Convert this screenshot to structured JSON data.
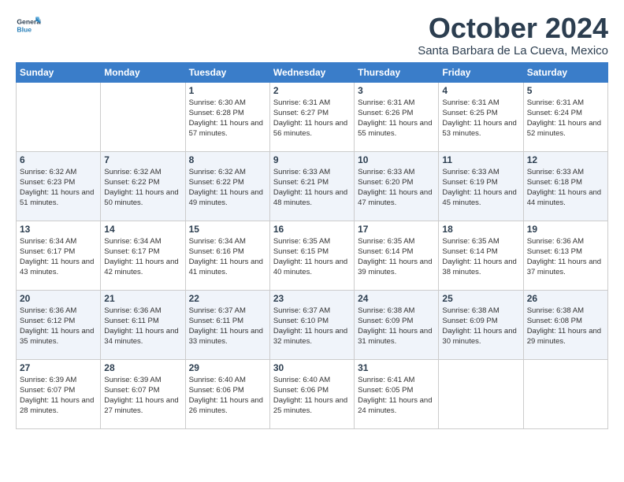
{
  "header": {
    "logo_line1": "General",
    "logo_line2": "Blue",
    "month": "October 2024",
    "location": "Santa Barbara de La Cueva, Mexico"
  },
  "weekdays": [
    "Sunday",
    "Monday",
    "Tuesday",
    "Wednesday",
    "Thursday",
    "Friday",
    "Saturday"
  ],
  "weeks": [
    [
      {
        "day": null
      },
      {
        "day": null
      },
      {
        "day": "1",
        "sunrise": "6:30 AM",
        "sunset": "6:28 PM",
        "daylight": "11 hours and 57 minutes."
      },
      {
        "day": "2",
        "sunrise": "6:31 AM",
        "sunset": "6:27 PM",
        "daylight": "11 hours and 56 minutes."
      },
      {
        "day": "3",
        "sunrise": "6:31 AM",
        "sunset": "6:26 PM",
        "daylight": "11 hours and 55 minutes."
      },
      {
        "day": "4",
        "sunrise": "6:31 AM",
        "sunset": "6:25 PM",
        "daylight": "11 hours and 53 minutes."
      },
      {
        "day": "5",
        "sunrise": "6:31 AM",
        "sunset": "6:24 PM",
        "daylight": "11 hours and 52 minutes."
      }
    ],
    [
      {
        "day": "6",
        "sunrise": "6:32 AM",
        "sunset": "6:23 PM",
        "daylight": "11 hours and 51 minutes."
      },
      {
        "day": "7",
        "sunrise": "6:32 AM",
        "sunset": "6:22 PM",
        "daylight": "11 hours and 50 minutes."
      },
      {
        "day": "8",
        "sunrise": "6:32 AM",
        "sunset": "6:22 PM",
        "daylight": "11 hours and 49 minutes."
      },
      {
        "day": "9",
        "sunrise": "6:33 AM",
        "sunset": "6:21 PM",
        "daylight": "11 hours and 48 minutes."
      },
      {
        "day": "10",
        "sunrise": "6:33 AM",
        "sunset": "6:20 PM",
        "daylight": "11 hours and 47 minutes."
      },
      {
        "day": "11",
        "sunrise": "6:33 AM",
        "sunset": "6:19 PM",
        "daylight": "11 hours and 45 minutes."
      },
      {
        "day": "12",
        "sunrise": "6:33 AM",
        "sunset": "6:18 PM",
        "daylight": "11 hours and 44 minutes."
      }
    ],
    [
      {
        "day": "13",
        "sunrise": "6:34 AM",
        "sunset": "6:17 PM",
        "daylight": "11 hours and 43 minutes."
      },
      {
        "day": "14",
        "sunrise": "6:34 AM",
        "sunset": "6:17 PM",
        "daylight": "11 hours and 42 minutes."
      },
      {
        "day": "15",
        "sunrise": "6:34 AM",
        "sunset": "6:16 PM",
        "daylight": "11 hours and 41 minutes."
      },
      {
        "day": "16",
        "sunrise": "6:35 AM",
        "sunset": "6:15 PM",
        "daylight": "11 hours and 40 minutes."
      },
      {
        "day": "17",
        "sunrise": "6:35 AM",
        "sunset": "6:14 PM",
        "daylight": "11 hours and 39 minutes."
      },
      {
        "day": "18",
        "sunrise": "6:35 AM",
        "sunset": "6:14 PM",
        "daylight": "11 hours and 38 minutes."
      },
      {
        "day": "19",
        "sunrise": "6:36 AM",
        "sunset": "6:13 PM",
        "daylight": "11 hours and 37 minutes."
      }
    ],
    [
      {
        "day": "20",
        "sunrise": "6:36 AM",
        "sunset": "6:12 PM",
        "daylight": "11 hours and 35 minutes."
      },
      {
        "day": "21",
        "sunrise": "6:36 AM",
        "sunset": "6:11 PM",
        "daylight": "11 hours and 34 minutes."
      },
      {
        "day": "22",
        "sunrise": "6:37 AM",
        "sunset": "6:11 PM",
        "daylight": "11 hours and 33 minutes."
      },
      {
        "day": "23",
        "sunrise": "6:37 AM",
        "sunset": "6:10 PM",
        "daylight": "11 hours and 32 minutes."
      },
      {
        "day": "24",
        "sunrise": "6:38 AM",
        "sunset": "6:09 PM",
        "daylight": "11 hours and 31 minutes."
      },
      {
        "day": "25",
        "sunrise": "6:38 AM",
        "sunset": "6:09 PM",
        "daylight": "11 hours and 30 minutes."
      },
      {
        "day": "26",
        "sunrise": "6:38 AM",
        "sunset": "6:08 PM",
        "daylight": "11 hours and 29 minutes."
      }
    ],
    [
      {
        "day": "27",
        "sunrise": "6:39 AM",
        "sunset": "6:07 PM",
        "daylight": "11 hours and 28 minutes."
      },
      {
        "day": "28",
        "sunrise": "6:39 AM",
        "sunset": "6:07 PM",
        "daylight": "11 hours and 27 minutes."
      },
      {
        "day": "29",
        "sunrise": "6:40 AM",
        "sunset": "6:06 PM",
        "daylight": "11 hours and 26 minutes."
      },
      {
        "day": "30",
        "sunrise": "6:40 AM",
        "sunset": "6:06 PM",
        "daylight": "11 hours and 25 minutes."
      },
      {
        "day": "31",
        "sunrise": "6:41 AM",
        "sunset": "6:05 PM",
        "daylight": "11 hours and 24 minutes."
      },
      {
        "day": null
      },
      {
        "day": null
      }
    ]
  ],
  "labels": {
    "sunrise": "Sunrise:",
    "sunset": "Sunset:",
    "daylight": "Daylight:"
  }
}
